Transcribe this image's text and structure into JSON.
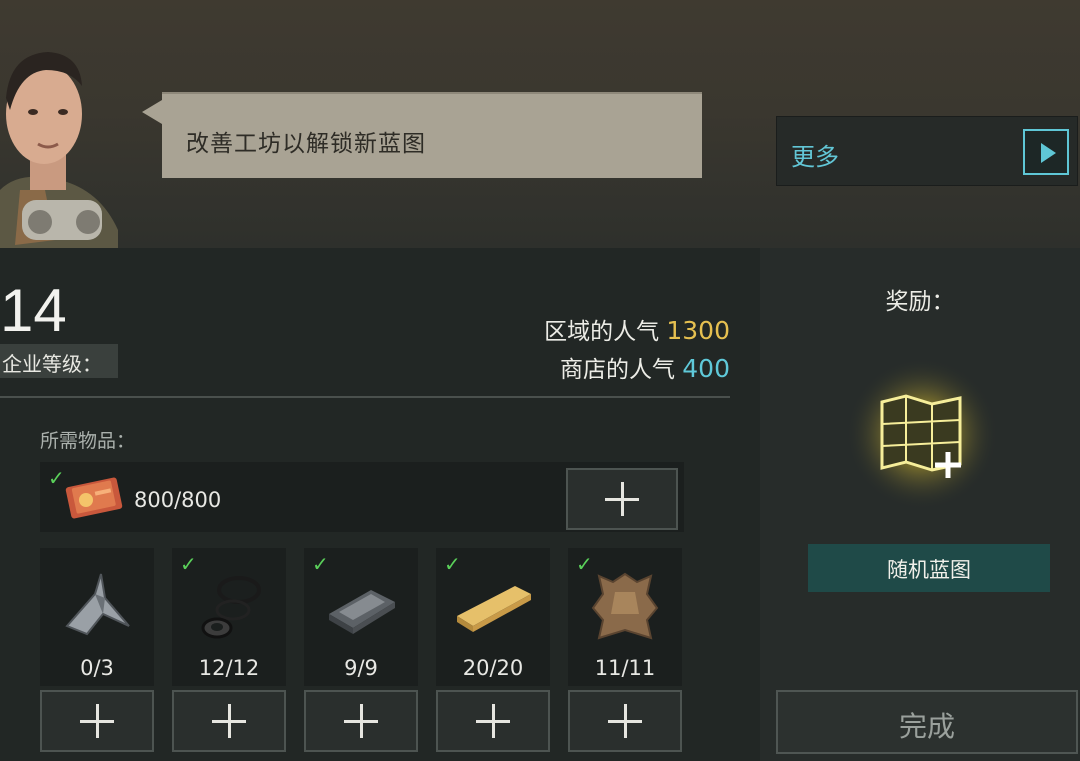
{
  "dialog": {
    "message": "改善工坊以解锁新蓝图"
  },
  "more_panel": {
    "label": "更多"
  },
  "company": {
    "level": "14",
    "level_label": "企业等级："
  },
  "popularity": {
    "region_label": "区域的人气",
    "region_value": "1300",
    "shop_label": "商店的人气",
    "shop_value": "400"
  },
  "requirements": {
    "label": "所需物品：",
    "money": {
      "count": "800/800",
      "icon": "money-card-icon",
      "completed": true
    },
    "items": [
      {
        "name": "metal-shards-icon",
        "count": "0/3",
        "completed": false
      },
      {
        "name": "rubber-rings-icon",
        "count": "12/12",
        "completed": true
      },
      {
        "name": "iron-ingot-icon",
        "count": "9/9",
        "completed": true
      },
      {
        "name": "wood-plank-icon",
        "count": "20/20",
        "completed": true
      },
      {
        "name": "leather-hide-icon",
        "count": "11/11",
        "completed": true
      }
    ]
  },
  "reward": {
    "title": "奖励：",
    "item_name": "随机蓝图",
    "icon": "blueprint-map-icon"
  },
  "actions": {
    "done_label": "完成"
  },
  "colors": {
    "accent_cyan": "#5fc7d6",
    "gold": "#e6c050",
    "check_green": "#5ad05a"
  }
}
